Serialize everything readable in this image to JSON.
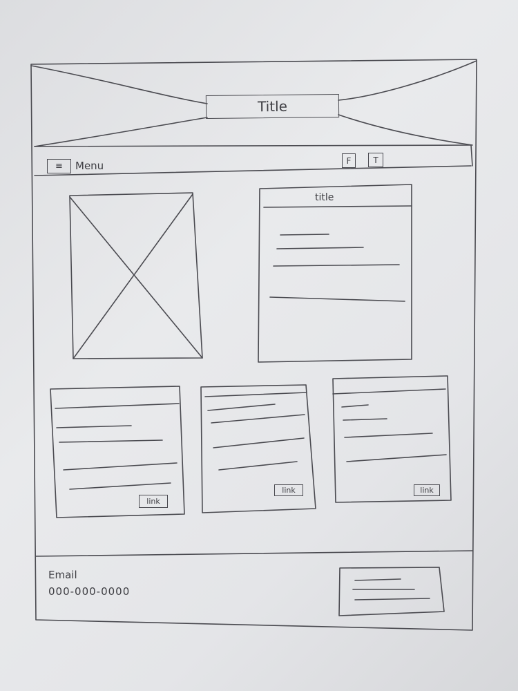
{
  "header": {
    "title": "Title"
  },
  "navbar": {
    "menu_label": "Menu",
    "social": [
      {
        "label": "F"
      },
      {
        "label": "T"
      }
    ]
  },
  "content_panel": {
    "title": "title"
  },
  "cards": [
    {
      "link_label": "link"
    },
    {
      "link_label": "link"
    },
    {
      "link_label": "link"
    }
  ],
  "footer": {
    "email_label": "Email",
    "phone": "000-000-0000"
  }
}
